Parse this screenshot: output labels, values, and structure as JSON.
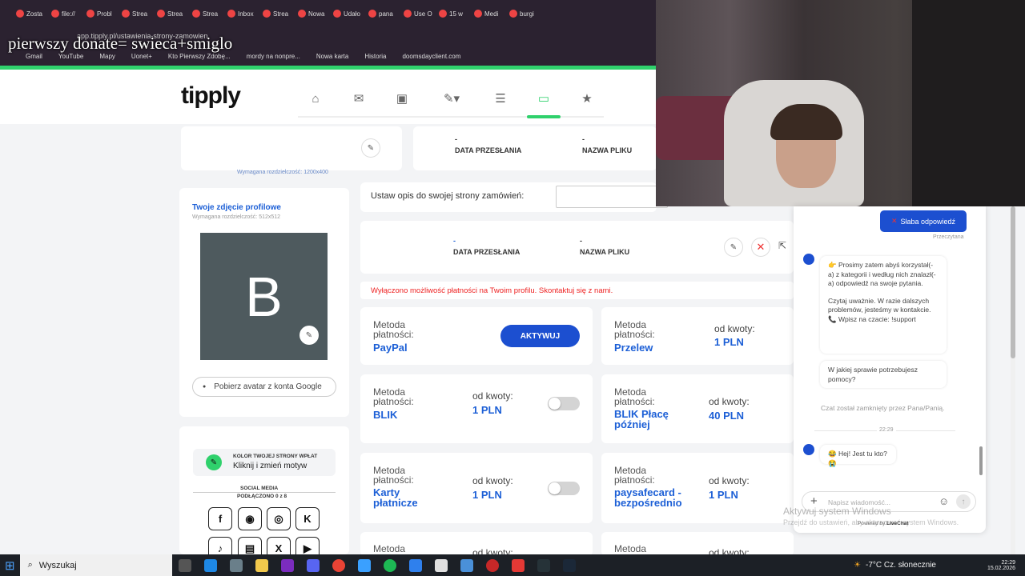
{
  "browser": {
    "tabs": [
      "Zosta",
      "file://",
      "Probl",
      "Strea",
      "Strea",
      "Strea",
      "Inbox",
      "Strea",
      "Nowa",
      "Udało",
      "pana",
      "Use O",
      "15 w",
      "Medi",
      "burgi"
    ],
    "address": "app.tipply.pl/ustawienia-strony-zamowien",
    "bookmarks": [
      "Gmail",
      "YouTube",
      "Mapy",
      "Uonet+",
      "Kto Pierwszy Zdobę...",
      "mordy na nonpre...",
      "Nowa karta",
      "Historia",
      "doomsdayclient.com"
    ]
  },
  "overlay_text": "pierwszy donate= swieca+smiglo",
  "logo": "tipply",
  "top_card": {
    "resolution_hint": "Wymagana rozdzielczość: 1200x400",
    "dash1": "-",
    "date_label": "DATA PRZESŁANIA",
    "dash2": "-",
    "file_label": "NAZWA PLIKU"
  },
  "profile": {
    "title": "Twoje zdjęcie profilowe",
    "resolution_hint": "Wymagana rozdzielczość: 512x512",
    "avatar_letter": "B",
    "google_button": "Pobierz avatar z konta Google"
  },
  "description": {
    "label": "Ustaw opis do swojej strony zamówień:",
    "value": ""
  },
  "file_card": {
    "dash1": "-",
    "date_label": "DATA PRZESŁANIA",
    "dash2": "-",
    "file_label": "NAZWA PLIKU"
  },
  "warning": "Wyłączono możliwość płatności na Twoim profilu. Skontaktuj się z nami.",
  "payment_methods": [
    {
      "title": "Metoda płatności:",
      "name": "PayPal",
      "action": "AKTYWUJ"
    },
    {
      "title": "Metoda płatności:",
      "name": "Przelew",
      "from": "od kwoty:",
      "amount": "1 PLN"
    },
    {
      "title": "Metoda płatności:",
      "name": "BLIK",
      "from": "od kwoty:",
      "amount": "1 PLN"
    },
    {
      "title": "Metoda płatności:",
      "name": "BLIK Płacę później",
      "from": "od kwoty:",
      "amount": "40 PLN"
    },
    {
      "title": "Metoda płatności:",
      "name": "Karty płatnicze",
      "from": "od kwoty:",
      "amount": "1 PLN"
    },
    {
      "title": "Metoda płatności:",
      "name": "paysafecard - bezpośrednio",
      "from": "od kwoty:",
      "amount": "1 PLN"
    },
    {
      "title": "Metoda",
      "from": "od kwoty:"
    },
    {
      "title": "Metoda",
      "from": "od kwoty:"
    }
  ],
  "theme": {
    "heading": "KOLOR TWOJEJ STRONY WPŁAT",
    "action": "Kliknij i zmień motyw",
    "social_heading": "SOCIAL MEDIA",
    "social_sub": "PODŁĄCZONO 0 z 8"
  },
  "chat": {
    "bad_answer": "Słaba odpowiedź",
    "read": "Przeczytana",
    "msg1": "👉 Prosimy zatem abyś korzystał(-a) z kategorii i według nich znalazł(-a) odpowiedź na swoje pytania.",
    "msg2": "Czytaj uważnie. W razie dalszych problemów, jesteśmy w kontakcie. 📞 Wpisz na czacie: !support",
    "msg3": "W jakiej sprawie potrzebujesz pomocy?",
    "closed": "Czat został zamknięty przez Pana/Panią.",
    "time": "22:29",
    "msg4": "😂 Hej! Jest tu kto? 😭",
    "input_placeholder": "Napisz wiadomość...",
    "powered": "Powered by",
    "brand": "LiveChat"
  },
  "watermark": {
    "line1": "Aktywuj system Windows",
    "line2": "Przejdź do ustawień, aby aktywować system Windows."
  },
  "taskbar": {
    "search_placeholder": "Wyszukaj",
    "weather": "-7°C Cz. słonecznie",
    "time": "22:29",
    "date": "15.02.2026"
  }
}
